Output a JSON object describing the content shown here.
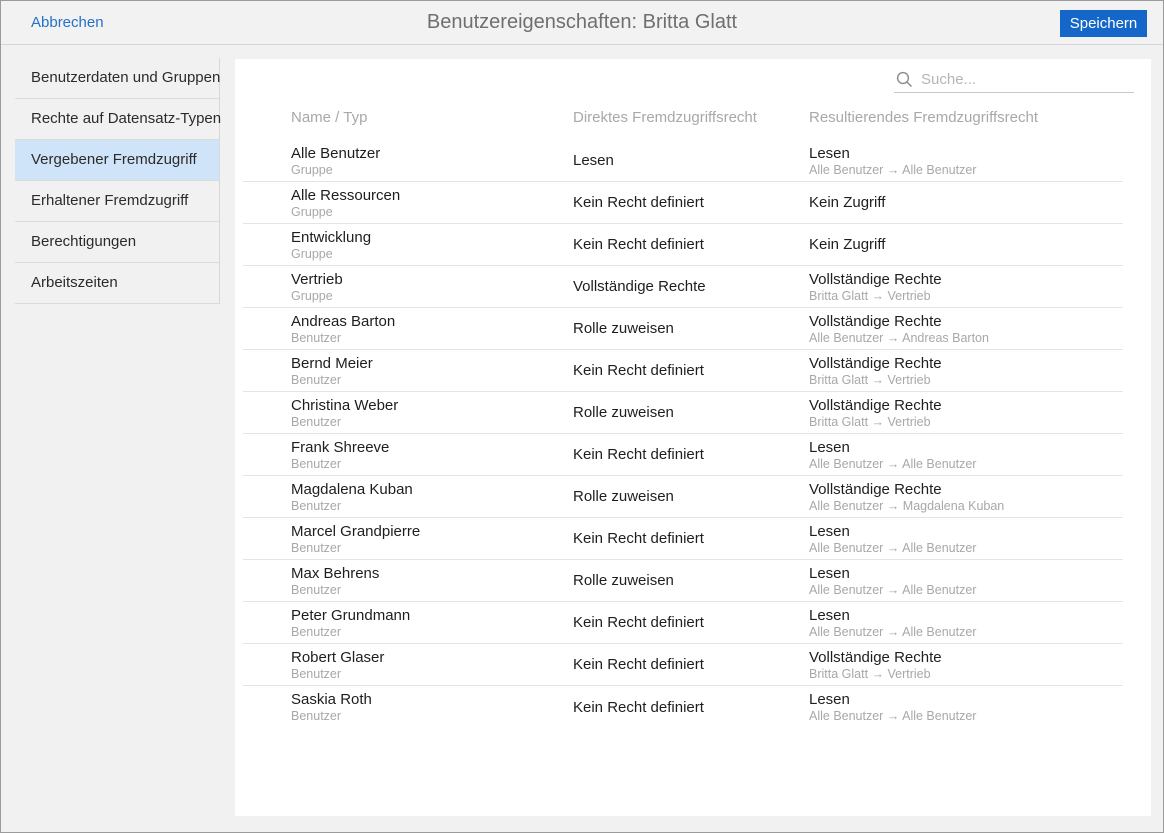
{
  "topbar": {
    "cancel_label": "Abbrechen",
    "title": "Benutzereigenschaften: Britta Glatt",
    "save_label": "Speichern"
  },
  "colors": {
    "accent_blue": "#1467c8",
    "link_blue": "#2272c8",
    "selected_item_bg": "#cfe4f8",
    "panel_bg": "#ffffff",
    "window_bg": "#f1f1f1"
  },
  "sidebar": {
    "active_index": 2,
    "items": [
      {
        "label": "Benutzerdaten und Gruppen"
      },
      {
        "label": "Rechte auf Datensatz-Typen"
      },
      {
        "label": "Vergebener Fremdzugriff"
      },
      {
        "label": "Erhaltener Fremdzugriff"
      },
      {
        "label": "Berechtigungen"
      },
      {
        "label": "Arbeitszeiten"
      }
    ]
  },
  "search": {
    "placeholder": "Suche...",
    "icon": "magnifier-icon",
    "value": ""
  },
  "table": {
    "columns": [
      "Name / Typ",
      "Direktes Fremdzugriffsrecht",
      "Resultierendes Fremdzugriffsrecht"
    ],
    "rows": [
      {
        "name": "Alle Benutzer",
        "type": "Gruppe",
        "direct_right": "Lesen",
        "resulting_right": "Lesen",
        "resulting_source": "Alle Benutzer → Alle Benutzer"
      },
      {
        "name": "Alle Ressourcen",
        "type": "Gruppe",
        "direct_right": "Kein Recht definiert",
        "resulting_right": "Kein Zugriff",
        "resulting_source": ""
      },
      {
        "name": "Entwicklung",
        "type": "Gruppe",
        "direct_right": "Kein Recht definiert",
        "resulting_right": "Kein Zugriff",
        "resulting_source": ""
      },
      {
        "name": "Vertrieb",
        "type": "Gruppe",
        "direct_right": "Vollständige Rechte",
        "resulting_right": "Vollständige Rechte",
        "resulting_source": "Britta Glatt → Vertrieb"
      },
      {
        "name": "Andreas Barton",
        "type": "Benutzer",
        "direct_right": "Rolle zuweisen",
        "resulting_right": "Vollständige Rechte",
        "resulting_source": "Alle Benutzer → Andreas Barton"
      },
      {
        "name": "Bernd Meier",
        "type": "Benutzer",
        "direct_right": "Kein Recht definiert",
        "resulting_right": "Vollständige Rechte",
        "resulting_source": "Britta Glatt → Vertrieb"
      },
      {
        "name": "Christina Weber",
        "type": "Benutzer",
        "direct_right": "Rolle zuweisen",
        "resulting_right": "Vollständige Rechte",
        "resulting_source": "Britta Glatt → Vertrieb"
      },
      {
        "name": "Frank Shreeve",
        "type": "Benutzer",
        "direct_right": "Kein Recht definiert",
        "resulting_right": "Lesen",
        "resulting_source": "Alle Benutzer → Alle Benutzer"
      },
      {
        "name": "Magdalena Kuban",
        "type": "Benutzer",
        "direct_right": "Rolle zuweisen",
        "resulting_right": "Vollständige Rechte",
        "resulting_source": "Alle Benutzer → Magdalena Kuban"
      },
      {
        "name": "Marcel Grandpierre",
        "type": "Benutzer",
        "direct_right": "Kein Recht definiert",
        "resulting_right": "Lesen",
        "resulting_source": "Alle Benutzer → Alle Benutzer"
      },
      {
        "name": "Max Behrens",
        "type": "Benutzer",
        "direct_right": "Rolle zuweisen",
        "resulting_right": "Lesen",
        "resulting_source": "Alle Benutzer → Alle Benutzer"
      },
      {
        "name": "Peter Grundmann",
        "type": "Benutzer",
        "direct_right": "Kein Recht definiert",
        "resulting_right": "Lesen",
        "resulting_source": "Alle Benutzer → Alle Benutzer"
      },
      {
        "name": "Robert Glaser",
        "type": "Benutzer",
        "direct_right": "Kein Recht definiert",
        "resulting_right": "Vollständige Rechte",
        "resulting_source": "Britta Glatt → Vertrieb"
      },
      {
        "name": "Saskia Roth",
        "type": "Benutzer",
        "direct_right": "Kein Recht definiert",
        "resulting_right": "Lesen",
        "resulting_source": "Alle Benutzer → Alle Benutzer"
      }
    ]
  }
}
